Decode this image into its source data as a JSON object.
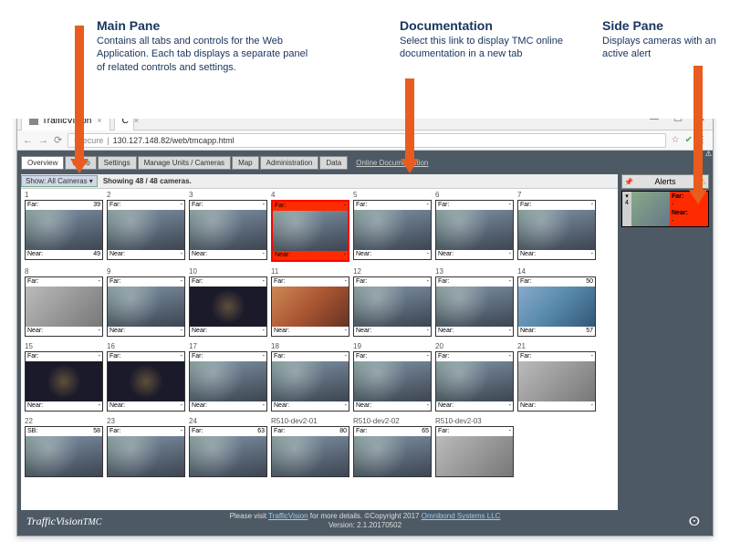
{
  "annotations": {
    "main": {
      "title": "Main Pane",
      "body": "Contains all tabs and controls for the Web Application. Each tab displays a separate panel of related controls and settings."
    },
    "doc": {
      "title": "Documentation",
      "body": "Select this link to display TMC online documentation in a new tab"
    },
    "side": {
      "title": "Side Pane",
      "body": "Displays cameras with an active alert"
    }
  },
  "browser": {
    "tab_title": "TrafficVision",
    "tab2_title": "C",
    "addr_prefix": "t secure",
    "url": "130.127.148.82/web/tmcapp.html"
  },
  "tabs": [
    "Overview",
    "Video",
    "Settings",
    "Manage Units / Cameras",
    "Map",
    "Administration",
    "Data"
  ],
  "active_tab": 0,
  "online_doc_label": "Online Documentation",
  "filter": {
    "show_label": "Show: All Cameras ▾",
    "status": "Showing 48 / 48 cameras."
  },
  "far_label": "Far:",
  "near_label": "Near:",
  "cameras": [
    {
      "id": "1",
      "far": "39",
      "near": "49",
      "cls": ""
    },
    {
      "id": "2",
      "far": "-",
      "near": "-",
      "cls": ""
    },
    {
      "id": "3",
      "far": "-",
      "near": "-",
      "cls": ""
    },
    {
      "id": "4",
      "far": "-",
      "near": "-",
      "cls": "",
      "alert": true
    },
    {
      "id": "5",
      "far": "-",
      "near": "-",
      "cls": ""
    },
    {
      "id": "6",
      "far": "-",
      "near": "-",
      "cls": ""
    },
    {
      "id": "7",
      "far": "-",
      "near": "-",
      "cls": ""
    },
    {
      "id": "8",
      "far": "-",
      "near": "-",
      "cls": "gray"
    },
    {
      "id": "9",
      "far": "-",
      "near": "-",
      "cls": ""
    },
    {
      "id": "10",
      "far": "-",
      "near": "-",
      "cls": "night"
    },
    {
      "id": "11",
      "far": "-",
      "near": "-",
      "cls": "orange"
    },
    {
      "id": "12",
      "far": "-",
      "near": "-",
      "cls": ""
    },
    {
      "id": "13",
      "far": "-",
      "near": "-",
      "cls": ""
    },
    {
      "id": "14",
      "far": "50",
      "near": "57",
      "cls": "blue"
    },
    {
      "id": "15",
      "far": "-",
      "near": "-",
      "cls": "night"
    },
    {
      "id": "16",
      "far": "-",
      "near": "-",
      "cls": "night"
    },
    {
      "id": "17",
      "far": "-",
      "near": "-",
      "cls": ""
    },
    {
      "id": "18",
      "far": "-",
      "near": "-",
      "cls": ""
    },
    {
      "id": "19",
      "far": "-",
      "near": "-",
      "cls": ""
    },
    {
      "id": "20",
      "far": "-",
      "near": "-",
      "cls": ""
    },
    {
      "id": "21",
      "far": "-",
      "near": "-",
      "cls": "gray"
    },
    {
      "id": "22",
      "far": "58",
      "near": "",
      "cls": "",
      "sb": true
    },
    {
      "id": "23",
      "far": "-",
      "near": "",
      "cls": ""
    },
    {
      "id": "24",
      "far": "63",
      "near": "",
      "cls": ""
    },
    {
      "id": "R510-dev2-01",
      "far": "80",
      "near": "",
      "cls": ""
    },
    {
      "id": "R510-dev2-02",
      "far": "65",
      "near": "",
      "cls": ""
    },
    {
      "id": "R510-dev2-03",
      "far": "-",
      "near": "",
      "cls": "gray"
    }
  ],
  "alerts": {
    "header": "Alerts",
    "items": [
      {
        "id": "4",
        "far": "-",
        "near": "-"
      }
    ]
  },
  "footer": {
    "logo1": "TrafficVision",
    "logo2": "TMC",
    "line1_a": "Please visit ",
    "line1_link1": "TrafficVision",
    "line1_b": " for more details.    ©Copyright 2017 ",
    "line1_link2": "Omnibond Systems LLC",
    "line2": "Version: 2.1.20170502"
  }
}
